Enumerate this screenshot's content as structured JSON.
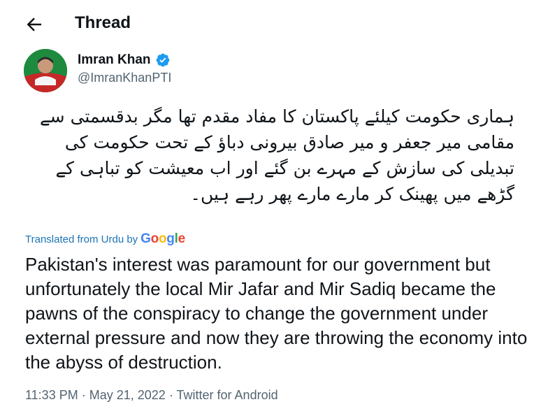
{
  "header": {
    "title": "Thread"
  },
  "tweet": {
    "name": "Imran Khan",
    "handle": "@ImranKhanPTI",
    "urdu_text": "ہماری حکومت کیلئے پاکستان کا مفاد مقدم تھا مگر بدقسمتی سے مقامی میر جعفر و میر صادق بیرونی دباؤ کے تحت حکومت کی تبدیلی کی سازش کے مہرے بن گئے اور اب معیشت کو تباہی کے گڑھے میں پھینک کر مارے مارے پھر رہے ہیں۔",
    "translated_label": "Translated from Urdu by",
    "translation": "Pakistan's interest was paramount for our government but unfortunately the local Mir Jafar and Mir Sadiq became the pawns of the conspiracy to change the government under external pressure and now they are throwing the economy into the abyss of destruction.",
    "time": "11:33 PM",
    "date": "May 21, 2022",
    "source": "Twitter for Android",
    "separator": "·"
  },
  "google": {
    "letters": [
      "G",
      "o",
      "o",
      "g",
      "l",
      "e"
    ],
    "colors": [
      "#4285f4",
      "#ea4335",
      "#fbbc05",
      "#4285f4",
      "#34a853",
      "#ea4335"
    ]
  },
  "colors": {
    "verified": "#1d9bf0",
    "link": "#1d74b4",
    "muted": "#536471"
  }
}
